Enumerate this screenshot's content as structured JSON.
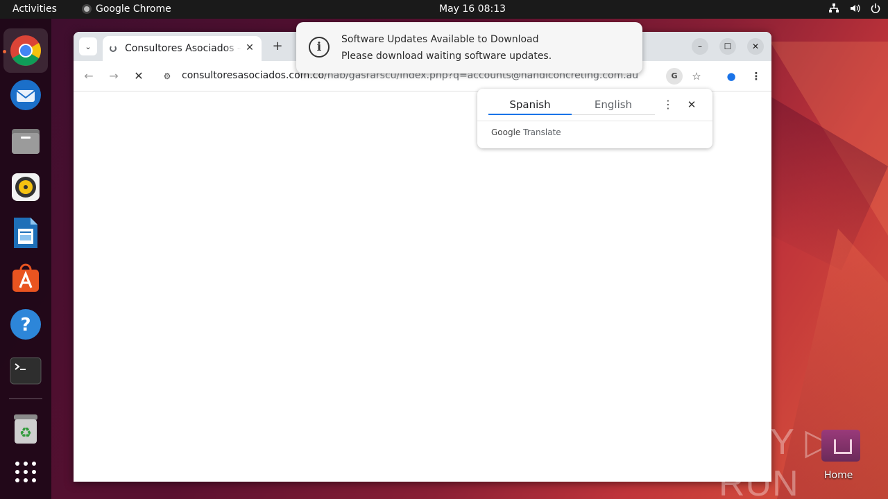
{
  "topbar": {
    "activities": "Activities",
    "app_name": "Google Chrome",
    "clock": "May 16  08:13"
  },
  "dock": {
    "items": [
      "Google Chrome",
      "Thunderbird Mail",
      "Files",
      "Rhythmbox",
      "LibreOffice Writer",
      "Ubuntu Software",
      "Help",
      "Terminal",
      "Trash",
      "Show Applications"
    ]
  },
  "browser": {
    "tab_title": "Consultores Asociados – Ingenieria",
    "url_host": "consultoresasociados.com.co",
    "url_path": "/nab/gasrarscu/index.php?q=accounts@handiconcreting.com.au"
  },
  "translate": {
    "source_lang": "Spanish",
    "target_lang": "English",
    "brand_google": "Google",
    "brand_translate": "Translate"
  },
  "notification": {
    "title": "Software Updates Available to Download",
    "body": "Please download waiting software updates."
  },
  "desktop": {
    "home_label": "Home",
    "watermark": "ANY ▷ RUN"
  },
  "colors": {
    "accent": "#1a73e8",
    "ubuntu_orange": "#e95420"
  }
}
